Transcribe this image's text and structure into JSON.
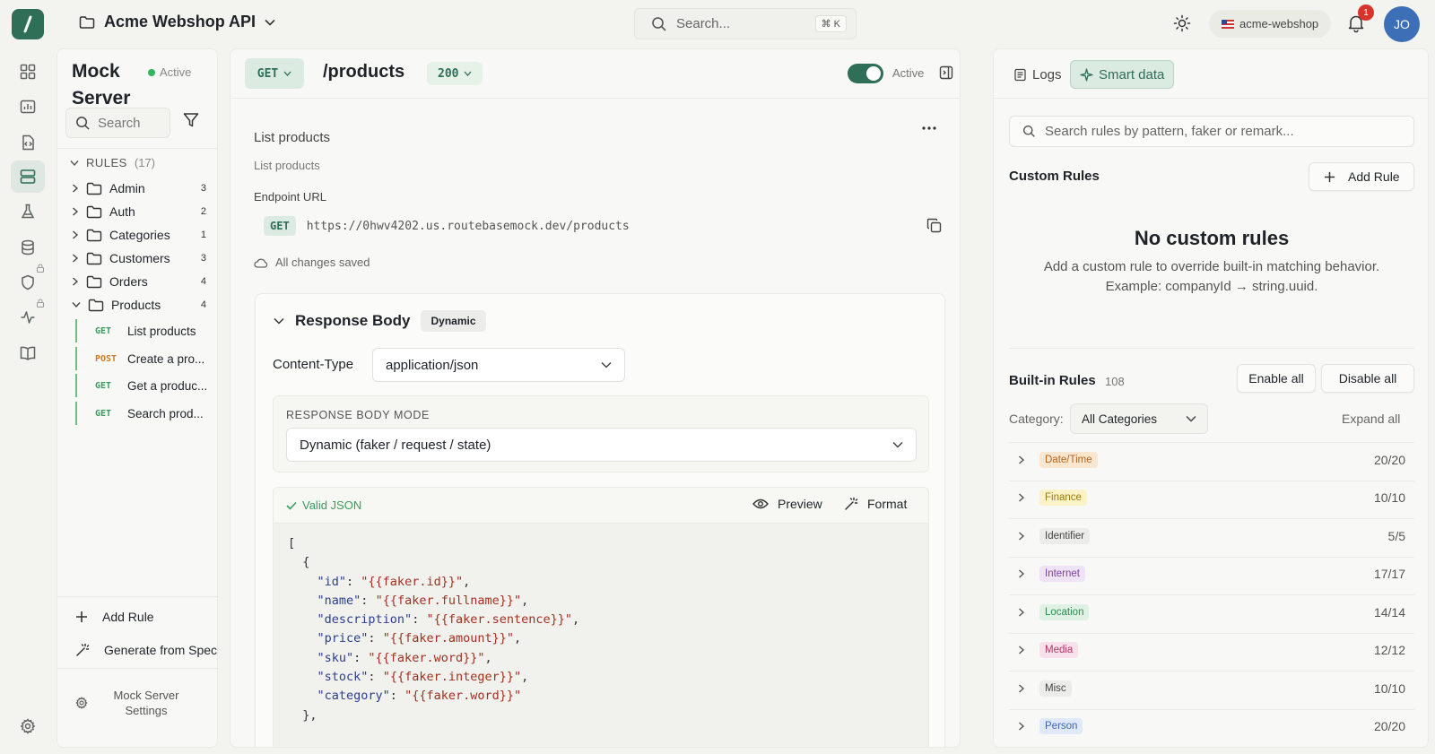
{
  "topbar": {
    "project_name": "Acme Webshop API",
    "search_placeholder": "Search...",
    "search_shortcut": "⌘ K",
    "workspace": "acme-webshop",
    "notification_count": "1",
    "avatar_initials": "JO"
  },
  "rail": {
    "icons": [
      "dashboard-icon",
      "analytics-icon",
      "code-icon",
      "mock-server-icon",
      "lab-icon",
      "database-icon",
      "shield-icon",
      "activity-icon",
      "book-icon",
      "settings-icon"
    ]
  },
  "tree": {
    "title": "Mock Server",
    "status": "Active",
    "search_placeholder": "Search",
    "rules_label": "RULES",
    "rules_count": "(17)",
    "folders": [
      {
        "name": "Admin",
        "count": "3"
      },
      {
        "name": "Auth",
        "count": "2"
      },
      {
        "name": "Categories",
        "count": "1"
      },
      {
        "name": "Customers",
        "count": "3"
      },
      {
        "name": "Orders",
        "count": "4"
      },
      {
        "name": "Products",
        "count": "4"
      }
    ],
    "endpoints": [
      {
        "method": "GET",
        "name": "List products"
      },
      {
        "method": "POST",
        "name": "Create a pro..."
      },
      {
        "method": "GET",
        "name": "Get a produc..."
      },
      {
        "method": "GET",
        "name": "Search prod..."
      }
    ],
    "add_rule": "Add Rule",
    "generate_from_spec": "Generate from Spec",
    "settings": "Mock Server Settings"
  },
  "main": {
    "method": "GET",
    "path": "/products",
    "status_code": "200",
    "active_label": "Active",
    "title": "List products",
    "description": "List products",
    "endpoint_url_label": "Endpoint URL",
    "url_method": "GET",
    "url": "https://0hwv4202.us.routebasemock.dev/products",
    "saved_status": "All changes saved",
    "response_body": {
      "title": "Response Body",
      "badge": "Dynamic",
      "content_type_label": "Content-Type",
      "content_type": "application/json",
      "mode_label": "RESPONSE BODY MODE",
      "mode": "Dynamic (faker / request / state)",
      "valid_label": "Valid JSON",
      "preview": "Preview",
      "format": "Format",
      "code_lines": [
        {
          "indent": "",
          "key": "",
          "value": "",
          "raw": "["
        },
        {
          "indent": "  ",
          "key": "",
          "value": "",
          "raw": "{"
        },
        {
          "indent": "    ",
          "key": "\"id\"",
          "value": "\"{{faker.id}}\"",
          "raw": ""
        },
        {
          "indent": "    ",
          "key": "\"name\"",
          "value": "\"{{faker.fullname}}\"",
          "raw": ""
        },
        {
          "indent": "    ",
          "key": "\"description\"",
          "value": "\"{{faker.sentence}}\"",
          "raw": ""
        },
        {
          "indent": "    ",
          "key": "\"price\"",
          "value": "\"{{faker.amount}}\"",
          "raw": ""
        },
        {
          "indent": "    ",
          "key": "\"sku\"",
          "value": "\"{{faker.word}}\"",
          "raw": ""
        },
        {
          "indent": "    ",
          "key": "\"stock\"",
          "value": "\"{{faker.integer}}\"",
          "raw": ""
        },
        {
          "indent": "    ",
          "key": "\"category\"",
          "value": "\"{{faker.word}}\"",
          "raw": ""
        },
        {
          "indent": "  ",
          "key": "",
          "value": "",
          "raw": "},"
        }
      ]
    }
  },
  "right": {
    "tab_logs": "Logs",
    "tab_smart": "Smart data",
    "search_placeholder": "Search rules by pattern, faker or remark...",
    "custom_rules_title": "Custom Rules",
    "add_rule": "Add Rule",
    "empty_title": "No custom rules",
    "empty_desc_1": "Add a custom rule to override built-in matching behavior.",
    "empty_desc_2": "Example: companyId → string.uuid.",
    "builtin_title": "Built-in Rules",
    "builtin_count": "108",
    "enable_all": "Enable all",
    "disable_all": "Disable all",
    "category_label": "Category:",
    "category_value": "All Categories",
    "expand_all": "Expand all",
    "categories": [
      {
        "name": "Date/Time",
        "count": "20/20",
        "bg": "#fbe6cf",
        "fg": "#b5651d"
      },
      {
        "name": "Finance",
        "count": "10/10",
        "bg": "#fbf3c6",
        "fg": "#9a7b10"
      },
      {
        "name": "Identifier",
        "count": "5/5",
        "bg": "#ececea",
        "fg": "#444444"
      },
      {
        "name": "Internet",
        "count": "17/17",
        "bg": "#efe3f7",
        "fg": "#7b3fa8"
      },
      {
        "name": "Location",
        "count": "14/14",
        "bg": "#def1e4",
        "fg": "#2f8a4f"
      },
      {
        "name": "Media",
        "count": "12/12",
        "bg": "#f8e1ea",
        "fg": "#b3336a"
      },
      {
        "name": "Misc",
        "count": "10/10",
        "bg": "#ececea",
        "fg": "#444444"
      },
      {
        "name": "Person",
        "count": "20/20",
        "bg": "#dfe9f8",
        "fg": "#3a67b0"
      }
    ]
  }
}
